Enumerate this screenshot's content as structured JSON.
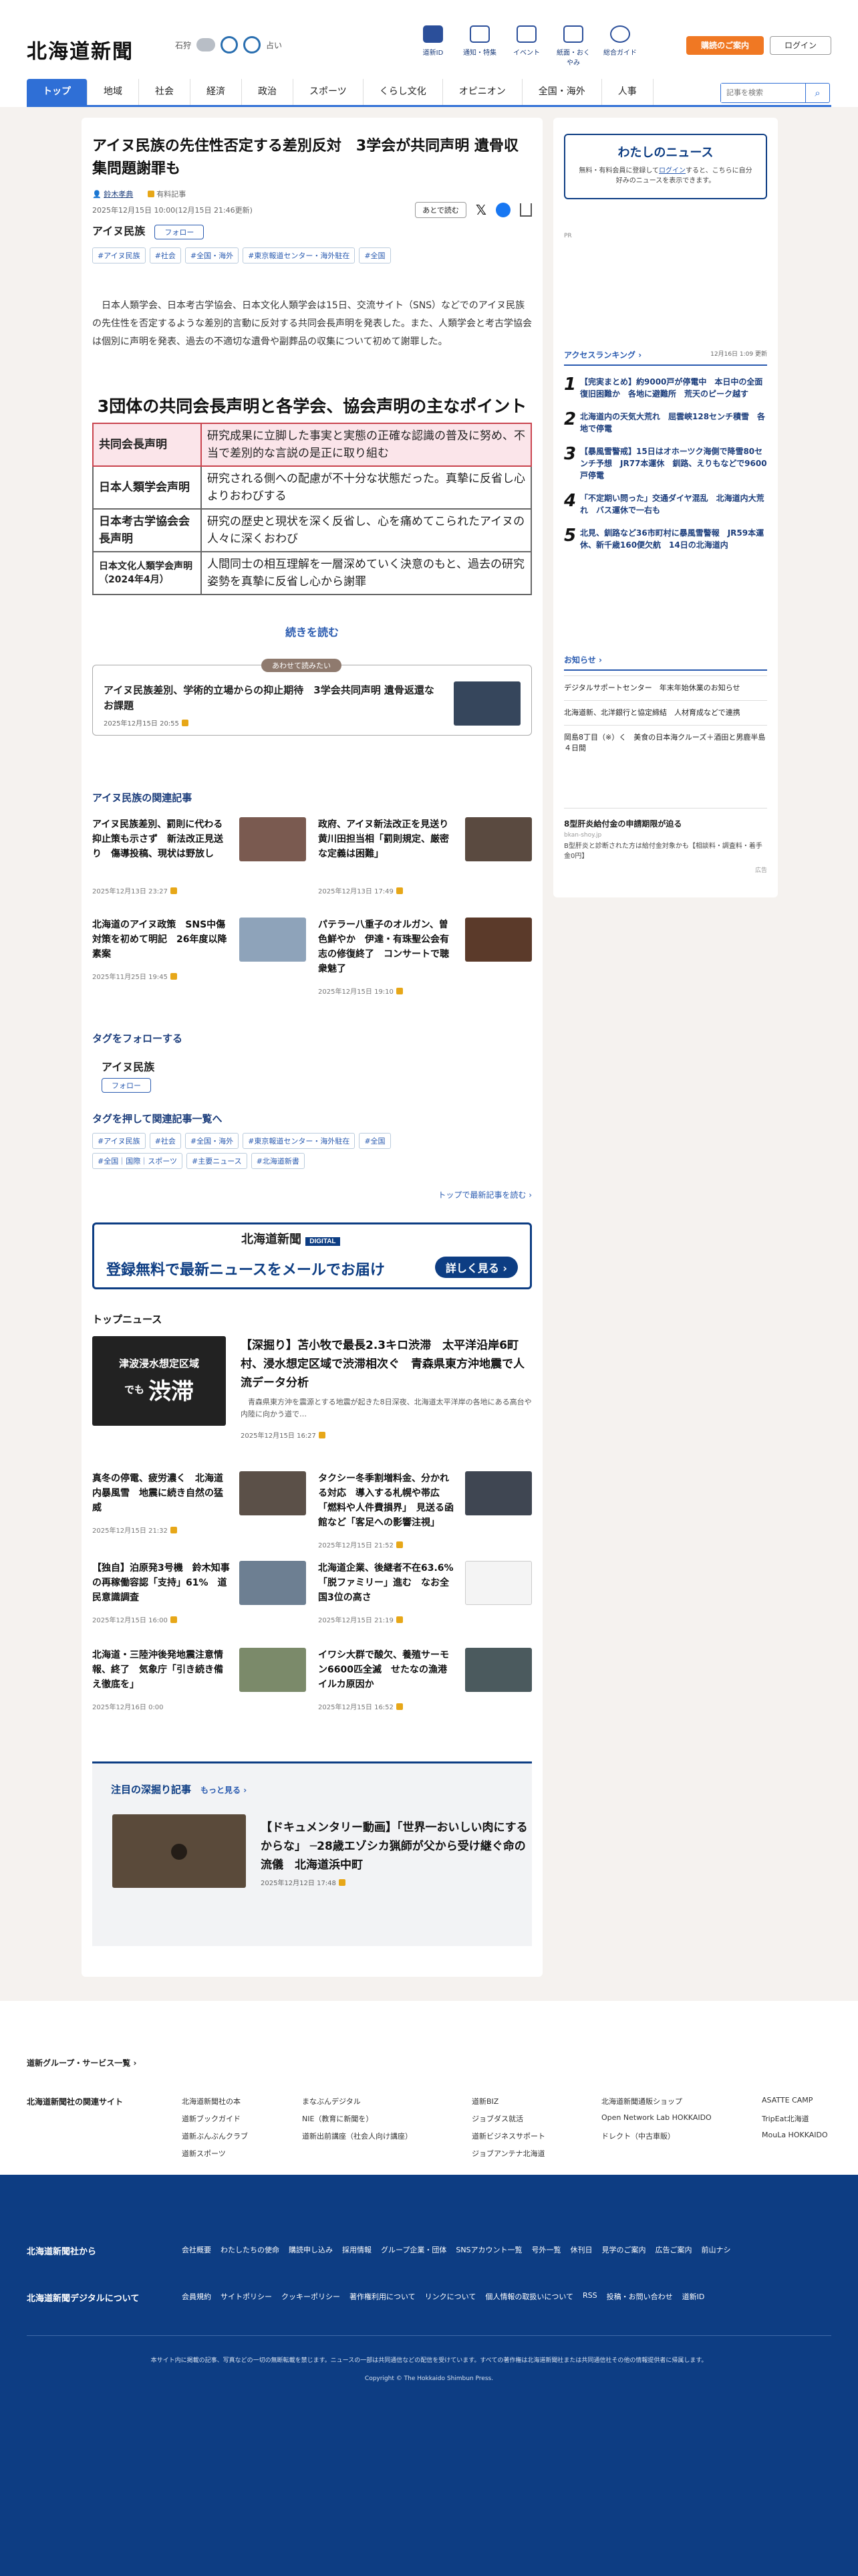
{
  "header": {
    "logo": "北海道新聞",
    "city": "石狩",
    "weather_label": "占い",
    "nav": [
      {
        "label": "道新ID"
      },
      {
        "label": "通知・特集"
      },
      {
        "label": "イベント"
      },
      {
        "label": "紙面・おくやみ"
      },
      {
        "label": "総合ガイド"
      }
    ],
    "subscribe": "購読のご案内",
    "login": "ログイン"
  },
  "gnav": [
    "トップ",
    "地域",
    "社会",
    "経済",
    "政治",
    "スポーツ",
    "くらし文化",
    "オピニオン",
    "全国・海外",
    "人事"
  ],
  "search_placeholder": "記事を検索",
  "article": {
    "title": "アイヌ民族の先住性否定する差別反対　3学会が共同声明 遺骨収集問題謝罪も",
    "author": "鈴木孝典",
    "author_badge": "有料記事",
    "date": "2025年12月15日 10:00(12月15日 21:46更新)",
    "readlater": "あとで読む",
    "topic": "アイヌ民族",
    "follow": "フォロー",
    "tags": [
      "#アイヌ民族",
      "#社会",
      "#全国・海外",
      "#東京報道センター・海外駐在",
      "#全国"
    ],
    "lead": "日本人類学会、日本考古学協会、日本文化人類学会は15日、交流サイト（SNS）などでのアイヌ民族の先住性を否定するような差別的言動に反対する共同会長声明を発表した。また、人類学会と考古学協会は個別に声明を発表、過去の不適切な遺骨や副葬品の収集について初めて謝罪した。",
    "points_title": "3団体の共同会長声明と各学会、協会声明の主なポイント",
    "points": [
      {
        "k": "共同会長声明",
        "v": "研究成果に立脚した事実と実態の正確な認識の普及に努め、不当で差別的な言説の是正に取り組む"
      },
      {
        "k": "日本人類学会声明",
        "v": "研究される側への配慮が不十分な状態だった。真摯に反省し心よりおわびする"
      },
      {
        "k": "日本考古学協会会長声明",
        "v": "研究の歴史と現状を深く反省し、心を痛めてこられたアイヌの人々に深くおわび"
      },
      {
        "k": "日本文化人類学会声明（2024年4月）",
        "v": "人間同士の相互理解を一層深めていく決意のもと、過去の研究姿勢を真摯に反省し心から謝罪"
      }
    ],
    "read_more": "続きを読む",
    "also_label": "あわせて読みたい",
    "also_title": "アイヌ民族差別、学術的立場からの抑止期待　3学会共同声明 遺骨返還なお課題",
    "also_date": "2025年12月15日 20:55"
  },
  "related": {
    "title": "アイヌ民族の関連記事",
    "items": [
      {
        "t": "アイヌ民族差別、罰則に代わる抑止策も示さず　新法改正見送り　傷導投稿、現状は野放し",
        "d": "2025年12月13日 23:27"
      },
      {
        "t": "政府、アイヌ新法改正を見送り　黄川田担当相「罰則規定、厳密な定義は困難」",
        "d": "2025年12月13日 17:49"
      },
      {
        "t": "北海道のアイヌ政策　SNS中傷対策を初めて明記　26年度以降素案",
        "d": "2025年11月25日 19:45"
      },
      {
        "t": "パテラー八重子のオルガン、曽色鮮やか　伊達・有珠聖公会有志の修復終了　コンサートで聴衆魅了",
        "d": "2025年12月15日 19:10"
      }
    ]
  },
  "follow_tag": {
    "title": "タグをフォローする",
    "name": "アイヌ民族",
    "btn": "フォロー"
  },
  "tag_list": {
    "title": "タグを押して関連記事一覧へ",
    "tags": [
      "#アイヌ民族",
      "#社会",
      "#全国・海外",
      "#東京報道センター・海外駐在",
      "#全国",
      "#全国｜国際｜スポーツ",
      "#主要ニュース",
      "#北海道新書"
    ],
    "to_top": "トップで最新記事を読む"
  },
  "banner": {
    "brand": "北海道新聞",
    "badge": "DIGITAL",
    "text": "登録無料で最新ニュースをメールでお届け",
    "btn": "詳しく見る"
  },
  "top_news": {
    "title": "トップニュース",
    "main_img_text_1": "津波浸水想定区域",
    "main_img_text_2": "渋滞",
    "main_img_text_3": "でも",
    "main": {
      "t": "【深掘り】苫小牧で最長2.3キロ渋滞　太平洋沿岸6町村、浸水想定区域で渋滞相次ぐ　青森県東方沖地震で人流データ分析",
      "s": "青森県東方沖を震源とする地震が起きた8日深夜、北海道太平洋岸の各地にある高台や内陸に向かう道で…",
      "d": "2025年12月15日 16:27"
    },
    "items": [
      {
        "t": "真冬の停電、疲労濃く　北海道内暴風雪　地震に続き自然の猛威",
        "d": "2025年12月15日 21:32"
      },
      {
        "t": "タクシー冬季割増料金、分かれる対応　導入する札幌や帯広「燃料や人件費損界」　見送る函館など「客足への影響注視」",
        "d": "2025年12月15日 21:52"
      },
      {
        "t": "【独自】泊原発3号機　鈴木知事の再稼働容認「支持」61%　道民意識調査",
        "d": "2025年12月15日 16:00"
      },
      {
        "t": "北海道企業、後継者不在63.6%「脱ファミリー」進む　なお全国3位の高さ",
        "d": "2025年12月15日 21:19"
      },
      {
        "t": "北海道・三陸沖後発地震注意情報、終了　気象庁「引き続き備え徹底を」",
        "d": "2025年12月16日 0:00"
      },
      {
        "t": "イワシ大群で酸欠、養殖サーモン6600匹全滅　せたなの漁港　イルカ原因か",
        "d": "2025年12月15日 16:52"
      }
    ]
  },
  "deep": {
    "title": "注目の深掘り記事",
    "more": "もっと見る",
    "t": "【ドキュメンタリー動画】「世界一おいしい肉にするからな」 ─28歳エゾシカ猟師が父から受け継ぐ命の流儀　北海道浜中町",
    "d": "2025年12月12日 17:48"
  },
  "mynews": {
    "title": "わたしのニュース",
    "desc1": "無料・有料会員に登録して",
    "login": "ログイン",
    "desc2": "すると、こちらに自分好みのニュースを表示できます。"
  },
  "pr": "PR",
  "ranking": {
    "title": "アクセスランキング",
    "updated": "12月16日 1:09 更新",
    "items": [
      "【完実まとめ】約9000戸が停電中　本日中の全面復旧困難か　各地に避難所　荒天のピーク越す",
      "北海道内の天気大荒れ　屈雲峡128センチ積雪　各地で停電",
      "【暴風雪警戒】15日はオホーツク海側で降雪80センチ予想　JR77本運休　釧路、えりもなどで9600戸停電",
      "「不定期い問った」交通ダイヤ混乱　北海道内大荒れ　バス運休で一右も",
      "北見、釧路など36市町村に暴風雪警報　JR59本運休、新千歳160便欠航　14日の北海道内"
    ]
  },
  "notice": {
    "title": "お知らせ",
    "items": [
      "デジタルサポートセンター　年末年始休業のお知らせ",
      "北海道新、北洋銀行と協定締結　人材育成などで連携",
      "岡島8丁目（※）く　美食の日本海クルーズ＋酒田と男鹿半島４日間"
    ]
  },
  "ad": {
    "title": "8型肝炎給付金の申請期限が迫る",
    "url": "bkan-shoy.jp",
    "desc": "B型肝炎と診断された方は給付金対象かも【相談料・調査料・着手金0円】",
    "label": "広告"
  },
  "footer": {
    "group": "道新グループ・サービス一覧",
    "related_title": "北海道新聞社の関連サイト",
    "related": [
      "北海道新聞社の本",
      "まなぶんデジタル",
      "道新BIZ",
      "北海道新聞通販ショップ",
      "ASATTE CAMP",
      "道新ブックガイド",
      "NIE（教育に新聞を）",
      "ジョブダス就活",
      "Open Network Lab HOKKAIDO",
      "TripEat北海道",
      "道新ぶんぶんクラブ",
      "道新出前講座（社会人向け講座）",
      "道新ビジネスサポート",
      "ドレクト（中古車販）",
      "MouLa HOKKAIDO",
      "道新スポーツ",
      "ジョブアンテナ北海道"
    ],
    "from_title": "北海道新聞社から",
    "from": [
      "会社概要",
      "わたしたちの使命",
      "購読申し込み",
      "採用情報",
      "グループ企業・団体",
      "SNSアカウント一覧",
      "号外一覧",
      "休刊日",
      "見学のご案内",
      "広告ご案内",
      "前山ナシ"
    ],
    "digital_title": "北海道新聞デジタルについて",
    "digital": [
      "会員規約",
      "サイトポリシー",
      "クッキーポリシー",
      "著作権利用について",
      "リンクについて",
      "個人情報の取扱いについて",
      "RSS",
      "投稿・お問い合わせ",
      "道新ID"
    ],
    "note": "本サイト内に掲載の記事、写真などの一切の無断転載を禁じます。ニュースの一部は共同通信などの配信を受けています。すべての著作権は北海道新聞社または共同通信社その他の情報提供者に帰属します。",
    "copyright": "Copyright © The Hokkaido Shimbun Press."
  }
}
